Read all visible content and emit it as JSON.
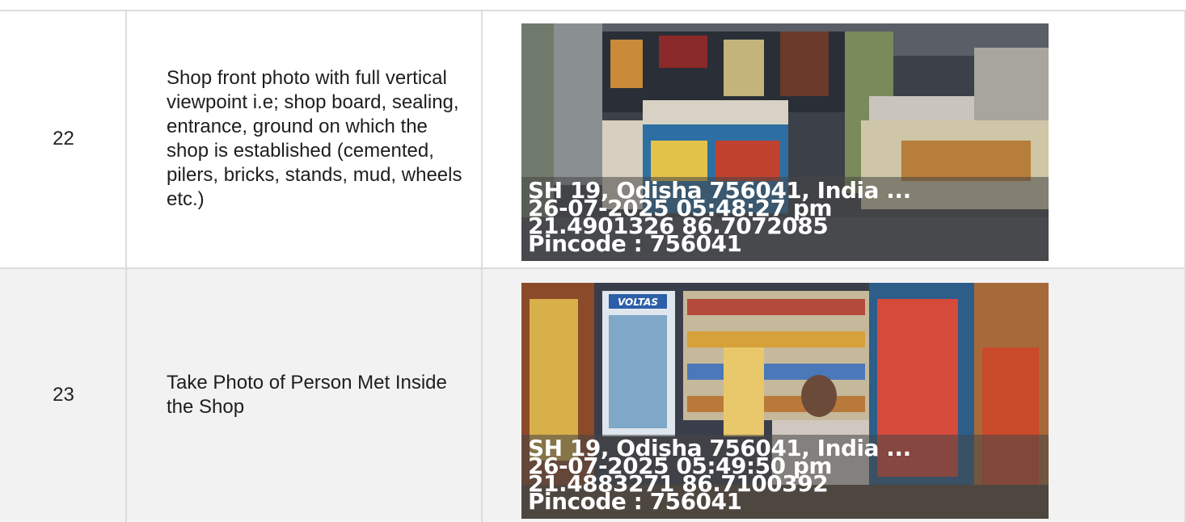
{
  "rows": [
    {
      "number": "22",
      "description": "Shop front photo with full vertical viewpoint i.e; shop board, sealing, entrance, ground on which the shop is established (cemented, pilers, bricks, stands, mud, wheels etc.)",
      "photo": {
        "address": "SH 19, Odisha 756041, India ...",
        "datetime": "26-07-2025 05:48:27 pm",
        "coordinates": "21.4901326 86.7072085",
        "pincode": "Pincode : 756041"
      }
    },
    {
      "number": "23",
      "description": "Take Photo of Person Met Inside the Shop",
      "photo": {
        "address": "SH 19, Odisha 756041, India ...",
        "datetime": "26-07-2025 05:49:50 pm",
        "coordinates": "21.4883271 86.7100392",
        "pincode": "Pincode : 756041",
        "fridge_brand": "VOLTAS"
      }
    }
  ]
}
